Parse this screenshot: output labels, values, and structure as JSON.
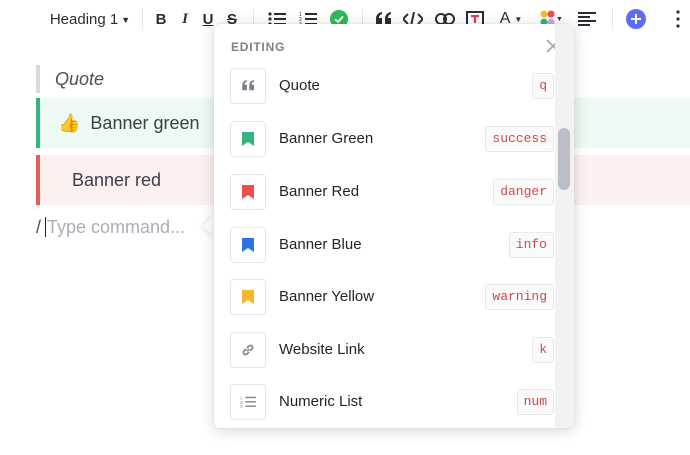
{
  "toolbar": {
    "heading_label": "Heading 1",
    "bold": "B",
    "italic": "I",
    "underline": "U",
    "strike": "S",
    "text_color_letter": "A",
    "icons": [
      "bullet-list-icon",
      "numbered-list-icon",
      "check-circle-icon",
      "quote-icon",
      "code-icon",
      "link-icon",
      "embed-icon",
      "text-color-icon",
      "color-palette-icon",
      "align-icon",
      "add-icon"
    ],
    "colors": {
      "check": "#2eb85c",
      "add": "#5b6cf5",
      "embed": "#d93d5c"
    }
  },
  "editor": {
    "quote_text": "Quote",
    "banner_green": {
      "emoji": "👍",
      "text": "Banner green"
    },
    "banner_red": {
      "text": "Banner red"
    },
    "command": {
      "slash": "/",
      "placeholder": "Type command..."
    }
  },
  "popup": {
    "title": "EDITING",
    "items": [
      {
        "label": "Quote",
        "key": "q",
        "icon": "quote-icon"
      },
      {
        "label": "Banner Green",
        "key": "success",
        "icon": "bookmark-green-icon",
        "color": "#36b37e"
      },
      {
        "label": "Banner Red",
        "key": "danger",
        "icon": "bookmark-red-icon",
        "color": "#ef4e4e"
      },
      {
        "label": "Banner Blue",
        "key": "info",
        "icon": "bookmark-blue-icon",
        "color": "#2f6fe8"
      },
      {
        "label": "Banner Yellow",
        "key": "warning",
        "icon": "bookmark-yellow-icon",
        "color": "#f5b82e"
      },
      {
        "label": "Website Link",
        "key": "k",
        "icon": "link-icon"
      },
      {
        "label": "Numeric List",
        "key": "num",
        "icon": "numbered-list-icon"
      }
    ]
  }
}
